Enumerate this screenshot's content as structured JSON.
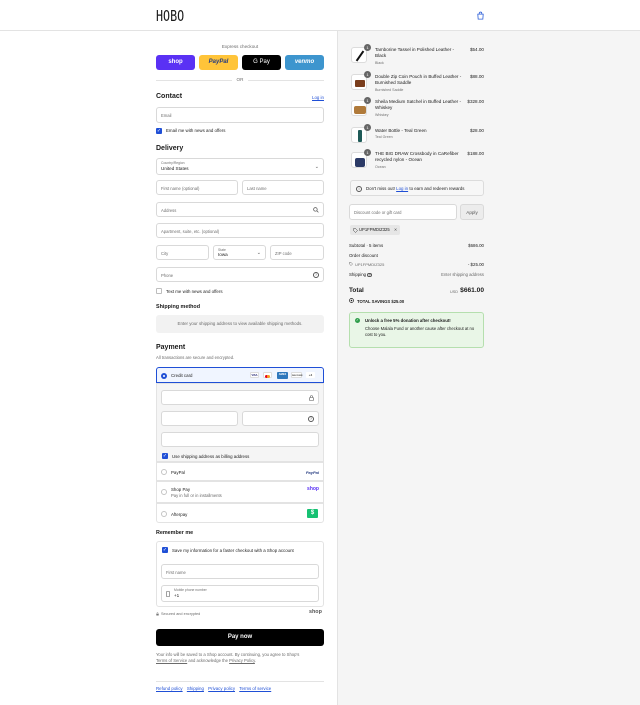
{
  "brand": {
    "logo": "HOBO"
  },
  "express": {
    "title": "Express checkout",
    "buttons": [
      {
        "label": "shop",
        "color": "#5a31f4"
      },
      {
        "label": "PayPal",
        "color": "#ffc439"
      },
      {
        "label": "G Pay",
        "color": "#000000"
      },
      {
        "label": "venmo",
        "color": "#3d95ce"
      }
    ],
    "or": "OR"
  },
  "contact": {
    "heading": "Contact",
    "login_link": "Log in",
    "email_placeholder": "Email",
    "news_label": "Email me with news and offers"
  },
  "delivery": {
    "heading": "Delivery",
    "country_label": "Country/Region",
    "country_value": "United States",
    "first_name": "First name (optional)",
    "last_name": "Last name",
    "address": "Address",
    "apartment": "Apartment, suite, etc. (optional)",
    "city": "City",
    "state_label": "State",
    "state_value": "Iowa",
    "zip": "ZIP code",
    "phone": "Phone",
    "text_me": "Text me with news and offers"
  },
  "shipping_method": {
    "heading": "Shipping method",
    "message": "Enter your shipping address to view available shipping methods."
  },
  "payment": {
    "heading": "Payment",
    "subtitle": "All transactions are secure and encrypted.",
    "credit_card_label": "Credit card",
    "card_logos": [
      "VISA",
      "MC",
      "AMEX",
      "DISCOVER",
      "+4"
    ],
    "use_shipping_label": "Use shipping address as billing address",
    "paypal_label": "PayPal",
    "paypal_logo": "PayPal",
    "shoppay_label": "Shop Pay",
    "shoppay_sub": "Pay in full or in installments",
    "shoppay_logo": "shop",
    "afterpay_label": "Afterpay",
    "afterpay_logo": "$"
  },
  "remember": {
    "heading": "Remember me",
    "save_label": "Save my information for a faster checkout with a Shop account",
    "first_name": "First name",
    "mobile_label": "Mobile phone number",
    "mobile_value": "+1",
    "secure": "Secured and encrypted",
    "shop_logo": "shop"
  },
  "pay_now": "Pay now",
  "legal": {
    "line1": "Your info will be saved to a Shop account. By continuing, you agree to Shop's",
    "terms": "Terms of Service",
    "and": "and acknowledge the",
    "privacy": "Privacy Policy",
    "end": "."
  },
  "footer_links": [
    "Refund policy",
    "Shipping",
    "Privacy policy",
    "Terms of service"
  ],
  "cart": {
    "items": [
      {
        "qty": "1",
        "name": "Tamborine Tassel in Polished Leather - Black",
        "variant": "Black",
        "price": "$54.00"
      },
      {
        "qty": "1",
        "name": "Double Zip Coin Pouch in Buffed Leather - Burnished Saddle",
        "variant": "Burnished Saddle",
        "price": "$88.00"
      },
      {
        "qty": "1",
        "name": "Sheila Medium Satchel in Buffed Leather - Whiskey",
        "variant": "Whiskey",
        "price": "$328.00"
      },
      {
        "qty": "1",
        "name": "Water Bottle - Teal Green",
        "variant": "Teal Green",
        "price": "$28.00"
      },
      {
        "qty": "1",
        "name": "THE BIG DRAW Crossbody in CaRefiber recycled nylon - Ocean",
        "variant": "Ocean",
        "price": "$188.00"
      }
    ],
    "rewards": "Don't miss out!",
    "rewards_link": "Log in",
    "rewards_rest": "to earn and redeem rewards",
    "discount_placeholder": "Discount code or gift card",
    "apply": "Apply",
    "code_tag": "UP1FPMDIZ325",
    "subtotal_label": "Subtotal · 5 items",
    "subtotal_value": "$686.00",
    "order_discount_label": "Order discount",
    "discount_code": "UP1FPMDIZ325",
    "discount_value": "- $25.00",
    "shipping_label": "Shipping",
    "shipping_value": "Enter shipping address",
    "total_label": "Total",
    "currency": "USD",
    "total_value": "$661.00",
    "savings_label": "TOTAL SAVINGS",
    "savings_value": "$25.00",
    "donation_title": "Unlock a free 5% donation after checkout!",
    "donation_text": "Choose Malala Fund or another cause after checkout at no cost to you."
  },
  "colors": {
    "accent": "#1f4fd6",
    "paynow": "#000000",
    "donation_bg": "#e9f6e7",
    "donation_border": "#b5dfae"
  }
}
